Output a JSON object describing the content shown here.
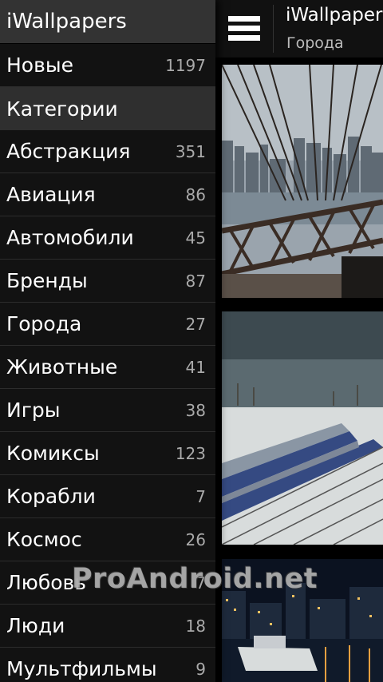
{
  "app_title": "iWallpapers",
  "content_header": {
    "title": "iWallpapers",
    "subtitle": "Города"
  },
  "drawer": {
    "header": "iWallpapers",
    "new_item": {
      "label": "Новые",
      "count": "1197"
    },
    "section_title": "Категории",
    "categories": [
      {
        "label": "Абстракция",
        "count": "351"
      },
      {
        "label": "Авиация",
        "count": "86"
      },
      {
        "label": "Автомобили",
        "count": "45"
      },
      {
        "label": "Бренды",
        "count": "87"
      },
      {
        "label": "Города",
        "count": "27"
      },
      {
        "label": "Животные",
        "count": "41"
      },
      {
        "label": "Игры",
        "count": "38"
      },
      {
        "label": "Комиксы",
        "count": "123"
      },
      {
        "label": "Корабли",
        "count": "7"
      },
      {
        "label": "Космос",
        "count": "26"
      },
      {
        "label": "Любовь",
        "count": "7"
      },
      {
        "label": "Люди",
        "count": "18"
      },
      {
        "label": "Мультфильмы",
        "count": "9"
      }
    ]
  },
  "watermark": "ProAndroid.net",
  "colors": {
    "drawer_bg": "#121212",
    "header_bg": "#333333",
    "section_bg": "#2f2f2f",
    "count_text": "#aaaaaa"
  },
  "icons": [
    "menu-icon"
  ]
}
